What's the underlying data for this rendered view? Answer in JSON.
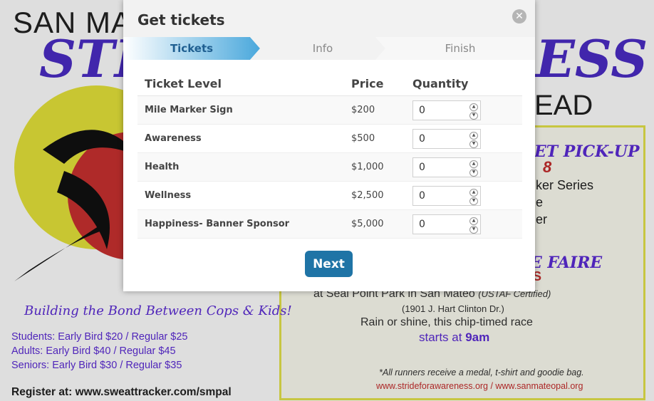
{
  "flyer": {
    "title_partial": "SAN MATE",
    "stride_left": "STR",
    "stride_right": "ESS",
    "ahead_partial": "EAD",
    "pickup_partial": "ET PICK-UP",
    "pickup_date_partial": "8",
    "series_partial": "ker Series",
    "line_e": "e",
    "line_er": "er",
    "faire_partial": "E FAIRE",
    "faire_sub_partial": "S",
    "location": "at Seal Point Park in San Mateo",
    "location_cert": "(USTAF Certified)",
    "address": "(1901 J. Hart Clinton Dr.)",
    "rain": "Rain or shine, this chip-timed race",
    "starts_prefix": "starts at ",
    "starts_time": "9am",
    "medal": "*All runners receive a medal, t-shirt and goodie bag.",
    "links": "www.strideforawareness.org / www.sanmateopal.org",
    "tagline": "Building the Bond Between Cops & Kids!",
    "prices": [
      "Students:  Early Bird $20 / Regular $25",
      "Adults:  Early Bird $40 / Regular $45",
      "Seniors:  Early Bird $30 / Regular $35"
    ],
    "register": "Register at:  www.sweattracker.com/smpal"
  },
  "modal": {
    "title": "Get tickets",
    "close_glyph": "✕",
    "steps": [
      "Tickets",
      "Info",
      "Finish"
    ],
    "columns": [
      "Ticket Level",
      "Price",
      "Quantity"
    ],
    "rows": [
      {
        "level": "Mile Marker Sign",
        "price": "$200",
        "quantity": "0"
      },
      {
        "level": "Awareness",
        "price": "$500",
        "quantity": "0"
      },
      {
        "level": "Health",
        "price": "$1,000",
        "quantity": "0"
      },
      {
        "level": "Wellness",
        "price": "$2,500",
        "quantity": "0"
      },
      {
        "level": "Happiness- Banner Sponsor",
        "price": "$5,000",
        "quantity": "0"
      }
    ],
    "next_label": "Next",
    "accent": "#1f74a6",
    "step_active_color": "#4aa8dc"
  }
}
